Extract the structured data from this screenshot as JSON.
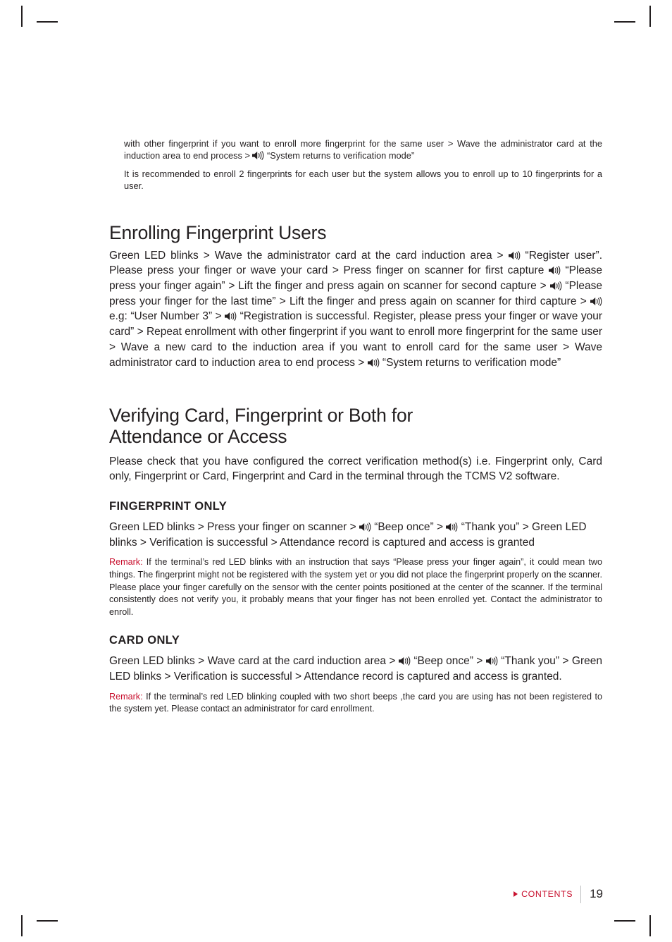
{
  "document": {
    "intro_paragraphs": [
      "with other fingerprint if you want to enroll more fingerprint for the same user > Wave the administrator card at the induction area to end process >  “System returns to verification mode”",
      "It is recommended to enroll 2 fingerprints for each user but the system allows you to enroll up to 10 fingerprints for a user."
    ],
    "sections": [
      {
        "heading": "Enrolling Fingerprint Users",
        "body": "Green LED blinks > Wave the administrator card at the card induction area >  “Register user”. Please press your finger or wave your card > Press finger on scanner for first capture  “Please press your finger again” > Lift the finger and press again on scanner for second capture >  “Please press your finger for the last time” > Lift the finger and press again on scanner for third capture >  e.g: “User Number 3” >  “Registration is successful. Register, please press your finger or wave your card” > Repeat enrollment with other fingerprint if you want to enroll more fingerprint for the same user > Wave a new card to the induction area if you want to enroll card for the same user > Wave administrator card to induction area to end process >  “System returns to verification mode”"
      },
      {
        "heading_line1": "Verifying Card, Fingerprint or Both for",
        "heading_line2": "Attendance or Access",
        "body": "Please check that you have configured the correct verification method(s) i.e. Fingerprint only, Card only, Fingerprint or Card, Fingerprint and Card in the terminal through the TCMS V2 software.",
        "subsections": [
          {
            "heading": "FINGERPRINT ONLY",
            "body": "Green LED blinks > Press your finger on scanner >  “Beep once” >  “Thank you” > Green LED blinks > Verification is successful > Attendance record is captured and access is granted",
            "remark_label": "Remark:",
            "remark_text": "If the terminal’s red LED blinks with an instruction that says “Please press your finger again”, it could mean two things. The fingerprint might not be registered with the system yet or you did not place the fingerprint properly on the scanner. Please place your finger carefully on the sensor with the center points positioned at the center of the scanner. If the terminal consistently does not verify you, it probably means that your finger has not been enrolled yet. Contact the administrator to enroll."
          },
          {
            "heading": "CARD ONLY",
            "body": "Green LED blinks > Wave card at the card induction area >  “Beep once” >  “Thank you” > Green LED blinks > Verification is successful > Attendance record is captured and access is granted.",
            "remark_label": "Remark:",
            "remark_text": "If the terminal’s red LED blinking coupled with two short beeps ,the card you are using has not been registered to the system yet. Please contact an administrator for card enrollment."
          }
        ]
      }
    ]
  },
  "footer": {
    "contents_label": "CONTENTS",
    "page_number": "19"
  },
  "colors": {
    "accent_red": "#c8102e",
    "text": "#231f20",
    "rule": "#bcbec0"
  },
  "icons": {
    "speaker": "speaker-icon",
    "contents_arrow": "triangle-right-icon"
  }
}
